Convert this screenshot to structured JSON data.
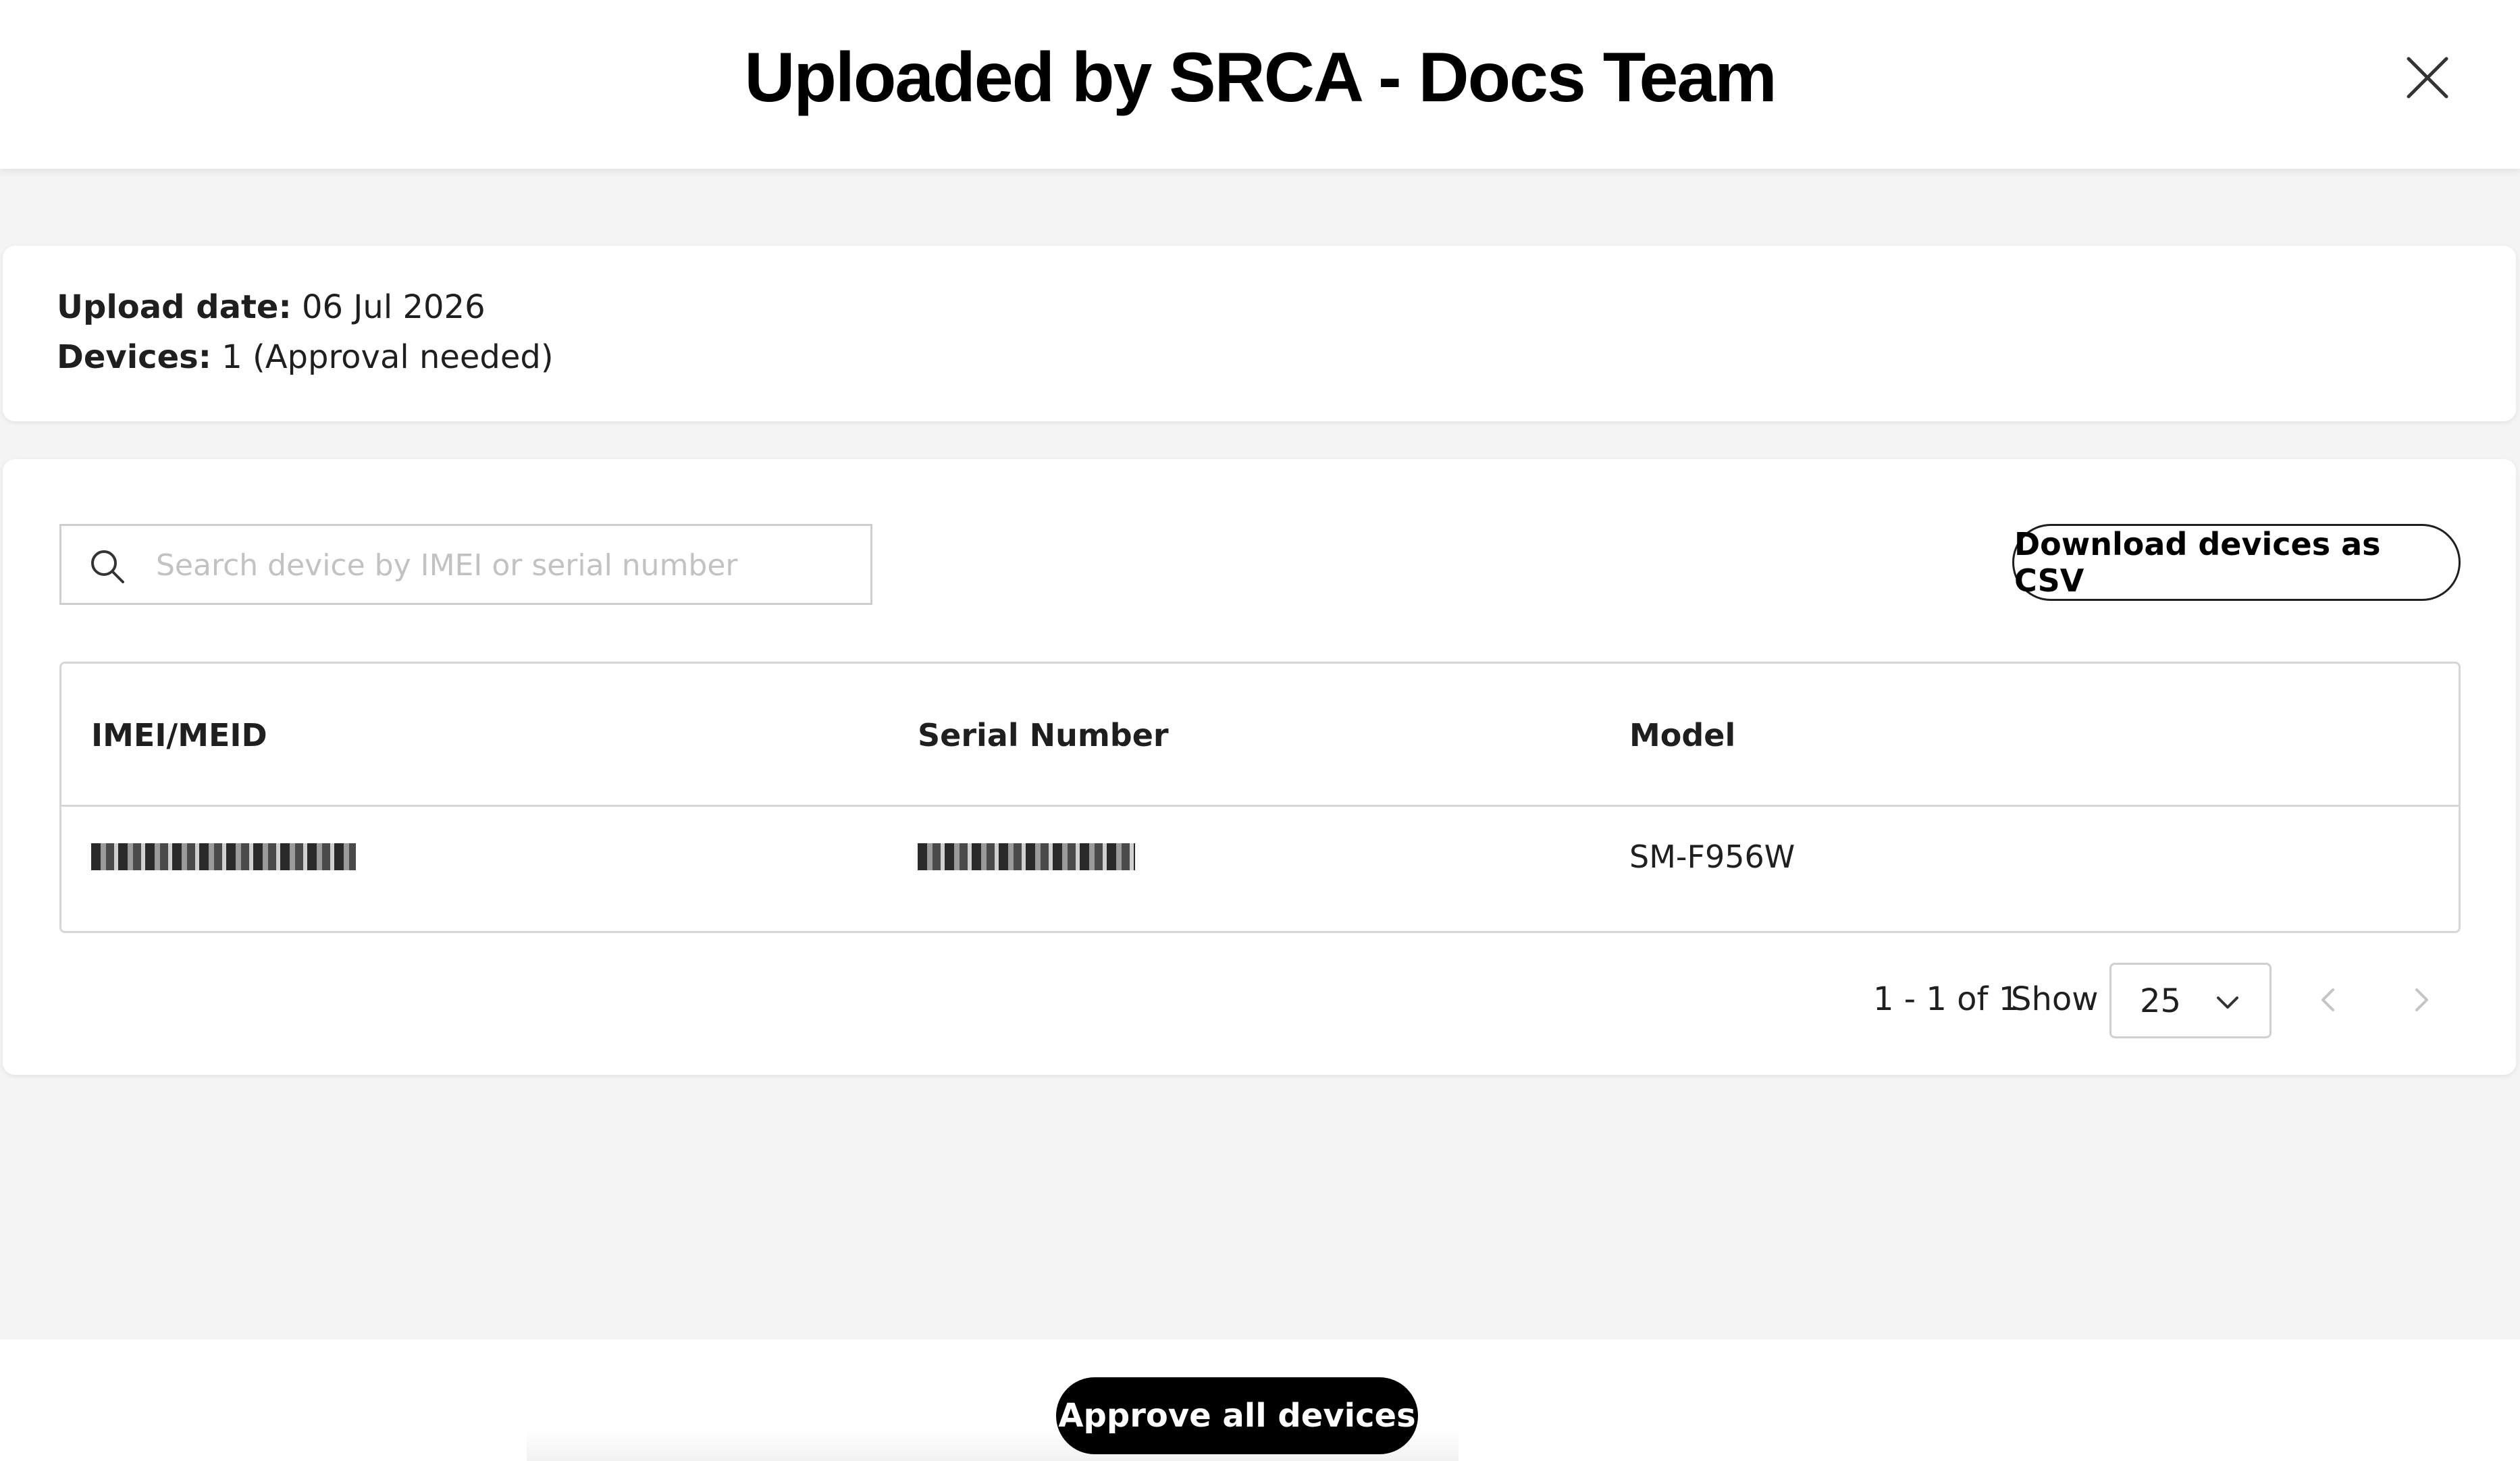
{
  "header": {
    "title": "Uploaded by SRCA - Docs Team"
  },
  "info": {
    "upload_date_label": "Upload date:",
    "upload_date_value": "06 Jul 2026",
    "devices_label": "Devices:",
    "devices_value": "1 (Approval needed)"
  },
  "search": {
    "placeholder": "Search device by IMEI or serial number",
    "value": ""
  },
  "toolbar": {
    "download_label": "Download devices as CSV"
  },
  "table": {
    "columns": [
      "IMEI/MEID",
      "Serial Number",
      "Model"
    ],
    "rows": [
      {
        "imei": "",
        "serial": "",
        "model": "SM-F956W"
      }
    ]
  },
  "pagination": {
    "range": "1 - 1 of 1",
    "show_label": "Show",
    "page_size": "25"
  },
  "footer": {
    "approve_label": "Approve all devices"
  },
  "icons": {
    "close": "close-icon",
    "search": "search-icon",
    "dropdown": "chevron-down-icon",
    "prev": "chevron-left-icon",
    "next": "chevron-right-icon"
  }
}
